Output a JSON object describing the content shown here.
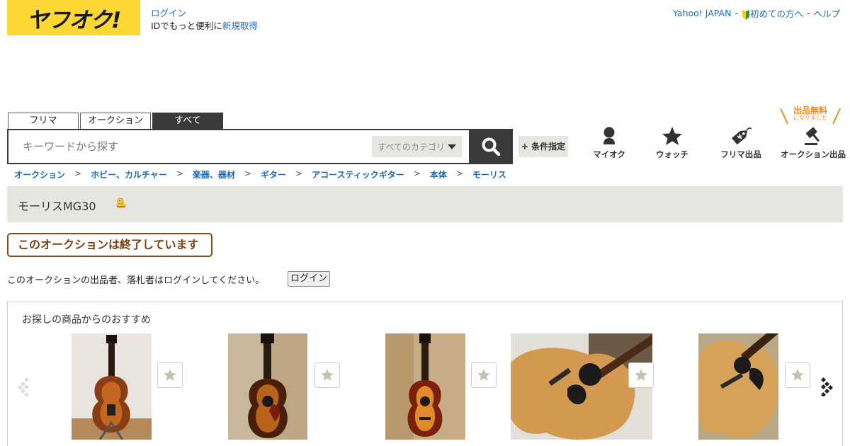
{
  "header": {
    "logo_text": "ヤフオク!",
    "login_link": "ログイン",
    "signup_prefix": "IDでもっと便利に",
    "signup_link": "新規取得",
    "top_links": {
      "yahoo": "Yahoo! JAPAN",
      "sep1": "-",
      "beginner": "初めての方へ",
      "sep2": "-",
      "help": "ヘルプ"
    }
  },
  "tabs": [
    {
      "label": "フリマ"
    },
    {
      "label": "オークション"
    },
    {
      "label": "すべて",
      "active": true
    }
  ],
  "search": {
    "placeholder": "キーワードから探す",
    "category": "すべてのカテゴリ",
    "condition_button": "+ 条件指定"
  },
  "nav_icons": {
    "myauc": {
      "label": "マイオク",
      "icon": "person-icon"
    },
    "watch": {
      "label": "ウォッチ",
      "icon": "star-icon"
    },
    "flea_sell": {
      "label": "フリマ出品",
      "icon": "price-tag-icon"
    },
    "auction_sell": {
      "label": "オークション出品",
      "icon": "gavel-icon"
    }
  },
  "free_listing": {
    "title": "出品無料",
    "sub": "になりました"
  },
  "breadcrumb": [
    "オークション",
    "ホビー、カルチャー",
    "楽器、器材",
    "ギター",
    "アコースティックギター",
    "本体",
    "モーリス"
  ],
  "breadcrumb_sep": ">",
  "item_title": "モーリスMG30",
  "ended_message": "このオークションは終了しています",
  "login_notice": "このオークションの出品者、落札者はログインしてください。",
  "login_button": "ログイン",
  "recommendations": {
    "heading": "お探しの商品からのおすすめ",
    "items": [
      {
        "image": "archtop-electric-guitar-sunburst"
      },
      {
        "image": "acoustic-guitar-sunburst-pickguard"
      },
      {
        "image": "acoustic-guitar-sunburst-small"
      },
      {
        "image": "acoustic-guitar-natural-dreadnought"
      },
      {
        "image": "acoustic-guitar-natural-closeup"
      }
    ]
  },
  "colors": {
    "brand_yellow": "#fdd835",
    "link_blue": "#1e6ab4",
    "dark": "#3a3a3a",
    "ended_brown": "#8b4a1c",
    "free_orange": "#f08c1e"
  }
}
